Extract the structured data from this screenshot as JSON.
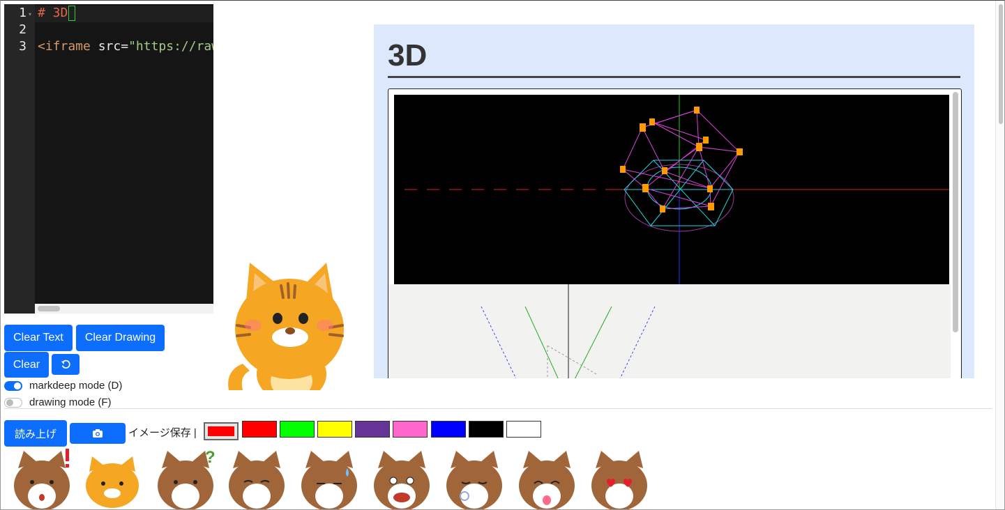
{
  "editor": {
    "lines": [
      {
        "num": "1",
        "heading": "# 3D"
      },
      {
        "num": "2"
      },
      {
        "num": "3",
        "tag": "<iframe",
        "attr": " src",
        "eq": "=",
        "str": "\"https://raw"
      }
    ]
  },
  "buttons": {
    "clear_text": "Clear Text",
    "clear_drawing": "Clear Drawing",
    "clear": "Clear",
    "undo_icon": "undo-icon",
    "read_aloud": "読み上げ",
    "camera_icon": "camera-icon"
  },
  "toggles": {
    "markdeep": {
      "label": "markdeep mode (D)",
      "on": true
    },
    "drawing": {
      "label": "drawing mode (F)",
      "on": false
    }
  },
  "toolbar": {
    "save_label": "イメージ保存 |"
  },
  "palette": {
    "colors": [
      "#ff0000",
      "#ff0000",
      "#00ff00",
      "#ffff00",
      "#663399",
      "#ff66cc",
      "#0000ff",
      "#000000",
      "#ffffff"
    ],
    "selected": 0
  },
  "preview": {
    "title": "3D"
  },
  "stickers": {
    "count": 9
  }
}
